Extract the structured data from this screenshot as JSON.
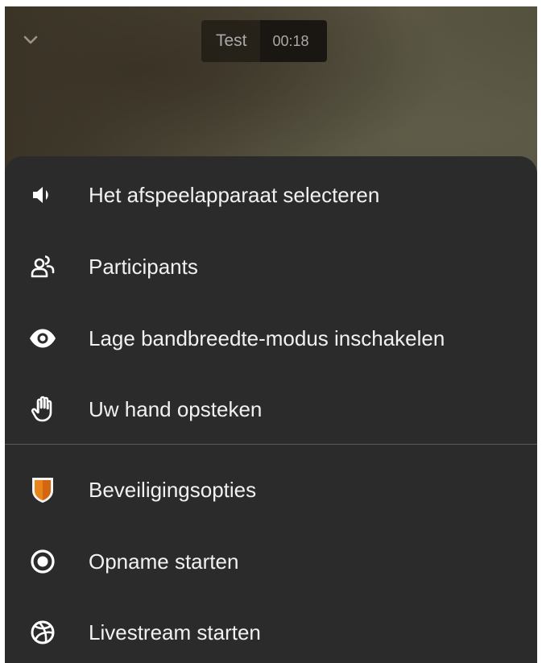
{
  "header": {
    "meeting_name": "Test",
    "elapsed_time": "00:18"
  },
  "menu": {
    "items": [
      {
        "id": "audio-device",
        "label": "Het afspeelapparaat selecteren",
        "icon": "speaker-icon"
      },
      {
        "id": "participants",
        "label": "Participants",
        "icon": "participants-icon"
      },
      {
        "id": "low-bandwidth",
        "label": "Lage bandbreedte-modus inschakelen",
        "icon": "eye-icon"
      },
      {
        "id": "raise-hand",
        "label": "Uw hand opsteken",
        "icon": "hand-icon"
      },
      {
        "id": "security",
        "label": "Beveiligingsopties",
        "icon": "shield-icon"
      },
      {
        "id": "recording",
        "label": "Opname starten",
        "icon": "record-icon"
      },
      {
        "id": "livestream",
        "label": "Livestream starten",
        "icon": "globe-icon"
      }
    ]
  },
  "colors": {
    "sheet_background": "#2b2b2b",
    "text": "#f1f1f1",
    "shield_orange": "#e8851a",
    "shield_border": "#f5f5f5"
  }
}
